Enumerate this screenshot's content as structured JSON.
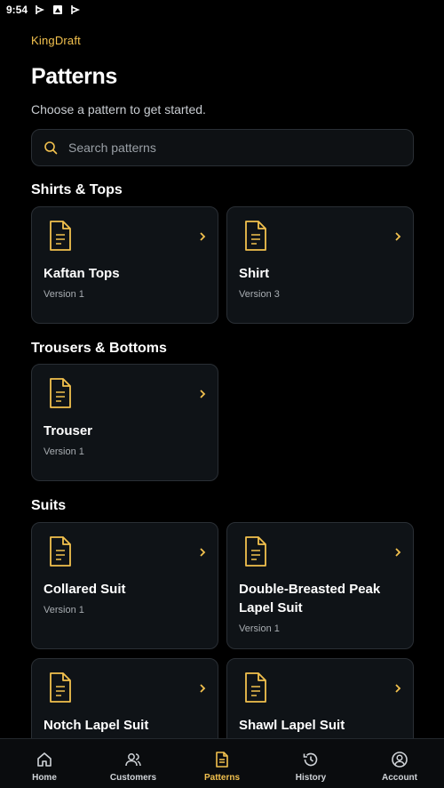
{
  "status_bar": {
    "time": "9:54"
  },
  "header": {
    "brand": "KingDraft",
    "title": "Patterns",
    "subtitle": "Choose a pattern to get started."
  },
  "search": {
    "placeholder": "Search patterns"
  },
  "sections": [
    {
      "title": "Shirts & Tops",
      "cards": [
        {
          "title": "Kaftan Tops",
          "version": "Version 1"
        },
        {
          "title": "Shirt",
          "version": "Version 3"
        }
      ]
    },
    {
      "title": "Trousers & Bottoms",
      "cards": [
        {
          "title": "Trouser",
          "version": "Version 1"
        }
      ]
    },
    {
      "title": "Suits",
      "cards": [
        {
          "title": "Collared Suit",
          "version": "Version 1"
        },
        {
          "title": "Double-Breasted Peak Lapel Suit",
          "version": "Version 1"
        },
        {
          "title": "Notch Lapel Suit",
          "version": ""
        },
        {
          "title": "Shawl Lapel Suit",
          "version": ""
        }
      ]
    }
  ],
  "bottom_nav": [
    {
      "label": "Home",
      "icon": "home-icon",
      "active": false
    },
    {
      "label": "Customers",
      "icon": "users-icon",
      "active": false
    },
    {
      "label": "Patterns",
      "icon": "document-icon",
      "active": true
    },
    {
      "label": "History",
      "icon": "history-icon",
      "active": false
    },
    {
      "label": "Account",
      "icon": "account-icon",
      "active": false
    }
  ],
  "colors": {
    "accent": "#f2c14e",
    "background": "#000000",
    "card": "#0f1317",
    "border": "#2a2f35"
  }
}
